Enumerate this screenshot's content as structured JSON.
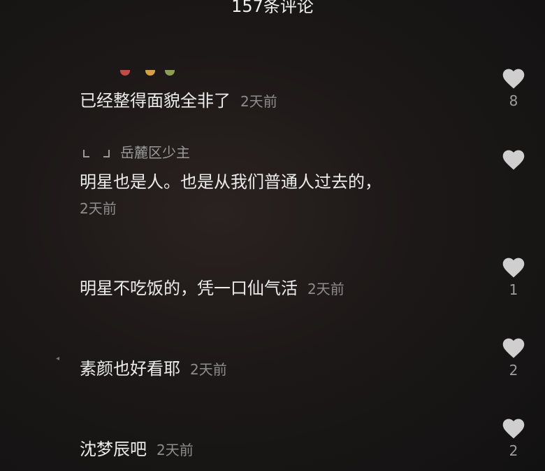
{
  "header": {
    "title": "157条评论"
  },
  "comments": [
    {
      "text": "已经整得面貌全非了",
      "time": "2天前",
      "likes": "8"
    },
    {
      "reply_to": "岳麓区少主",
      "text": "明星也是人。也是从我们普通人过去的，",
      "time": "2天前",
      "likes": ""
    },
    {
      "text": "明星不吃饭的，凭一口仙气活",
      "time": "2天前",
      "likes": "1"
    },
    {
      "text": "素颜也好看耶",
      "time": "2天前",
      "likes": "2"
    },
    {
      "text": "沈梦辰吧",
      "time": "2天前",
      "likes": "2"
    }
  ],
  "icons": {
    "like": "heart-icon",
    "reply": "reply-arrow-icon"
  },
  "colors": {
    "heart": "#cfcfcf",
    "time": "#8d8d8d",
    "text": "#ececec"
  }
}
